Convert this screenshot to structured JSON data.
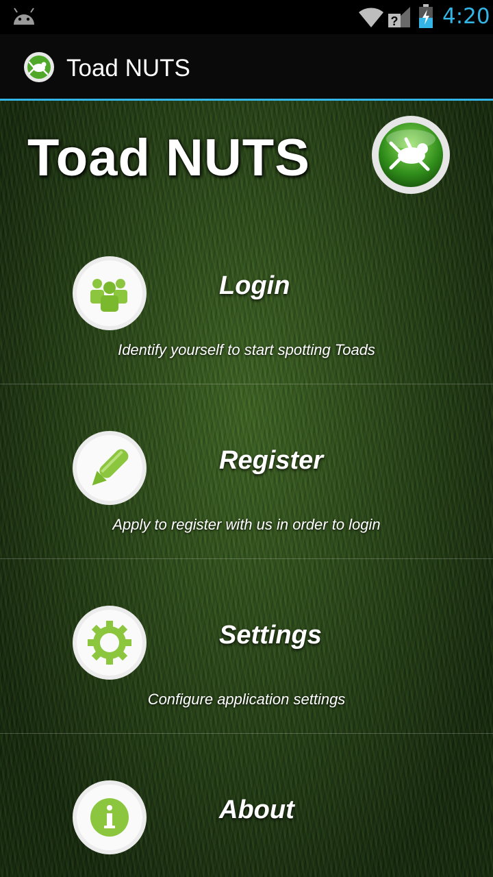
{
  "status_bar": {
    "time": "4:20",
    "icons": [
      "android-icon",
      "wifi-icon",
      "signal-icon",
      "battery-charging-icon"
    ],
    "accent": "#33b5e5"
  },
  "action_bar": {
    "title": "Toad NUTS",
    "logo_icon": "toad-logo-icon"
  },
  "header": {
    "title": "Toad NUTS",
    "logo_icon": "toad-logo-icon"
  },
  "menu": {
    "items": [
      {
        "label": "Login",
        "description": "Identify yourself to start spotting Toads",
        "icon": "users-icon"
      },
      {
        "label": "Register",
        "description": "Apply to register with us in order to login",
        "icon": "pencil-icon"
      },
      {
        "label": "Settings",
        "description": "Configure application settings",
        "icon": "gear-icon"
      },
      {
        "label": "About",
        "description": "",
        "icon": "info-icon"
      }
    ]
  },
  "colors": {
    "accent_green": "#8cc63f",
    "background_grass": "#2f5520"
  }
}
